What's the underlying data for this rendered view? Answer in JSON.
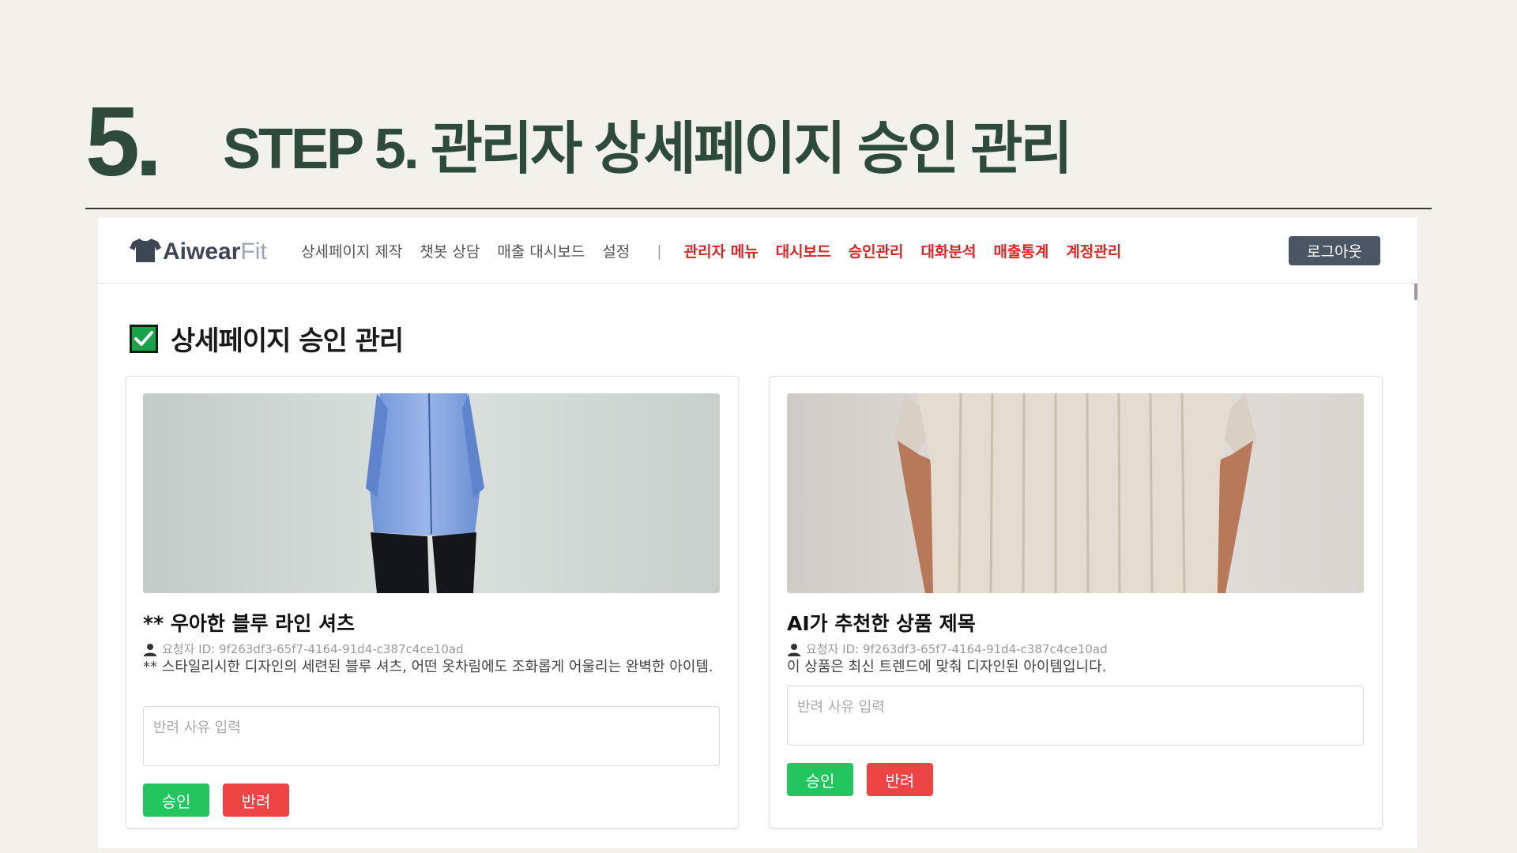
{
  "slide": {
    "number": "5.",
    "title": "STEP 5. 관리자 상세페이지 승인 관리"
  },
  "navbar": {
    "logo_main": "Aiwear",
    "logo_accent": "Fit",
    "links": [
      "상세페이지 제작",
      "챗봇 상담",
      "매출 대시보드",
      "설정"
    ],
    "separator": "|",
    "admin_links": [
      "관리자 메뉴",
      "대시보드",
      "승인관리",
      "대화분석",
      "매출통계",
      "계정관리"
    ],
    "logout_label": "로그아웃"
  },
  "page": {
    "heading": "상세페이지 승인 관리"
  },
  "cards": [
    {
      "title": "** 우아한 블루 라인 셔츠",
      "requester": "요청자 ID: 9f263df3-65f7-4164-91d4-c387c4ce10ad",
      "description": "** 스타일리시한 디자인의 세련된 블루 셔츠, 어떤 옷차림에도 조화롭게 어울리는 완벽한 아이템.",
      "reason_placeholder": "반려 사유 입력",
      "approve_label": "승인",
      "reject_label": "반려"
    },
    {
      "title": "AI가 추천한 상품 제목",
      "requester": "요청자 ID: 9f263df3-65f7-4164-91d4-c387c4ce10ad",
      "description": "이 상품은 최신 트렌드에 맞춰 디자인된 아이템입니다.",
      "reason_placeholder": "반려 사유 입력",
      "approve_label": "승인",
      "reject_label": "반려"
    }
  ],
  "colors": {
    "title_green": "#2d4a3a",
    "admin_red": "#e02424",
    "approve_green": "#22c55e",
    "reject_red": "#ef4444",
    "logout_gray": "#4b5563"
  },
  "icons": [
    "tshirt-logo-icon",
    "check-box-icon",
    "person-icon"
  ]
}
